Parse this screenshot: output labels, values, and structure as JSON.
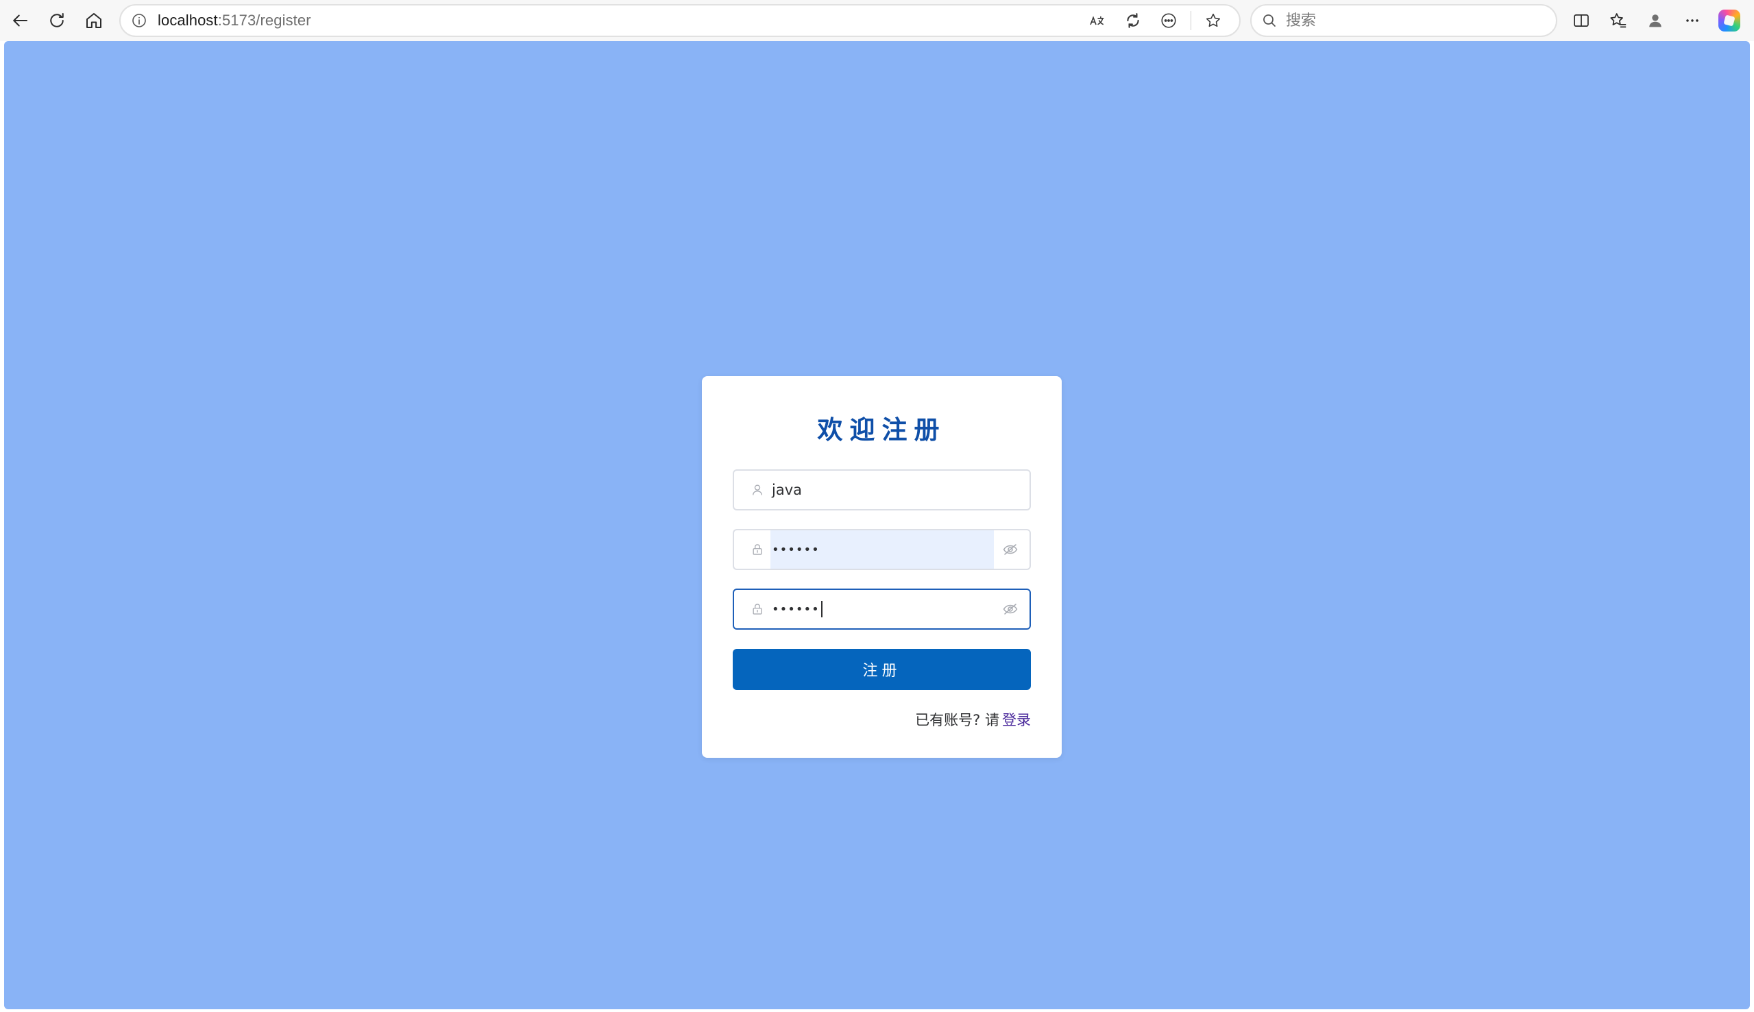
{
  "browser": {
    "address": {
      "host": "localhost",
      "path": ":5173/register"
    },
    "search": {
      "placeholder": "搜索"
    },
    "icons": {
      "back": "back-arrow-icon",
      "refresh": "refresh-icon",
      "home": "home-icon",
      "site_info": "info-icon",
      "read_aloud": "translate-icon",
      "browser_essentials": "refresh-shield-icon",
      "more_in_address": "more-circle-icon",
      "favorite": "star-icon",
      "split_screen": "split-screen-icon",
      "favorites": "favorites-icon",
      "profile": "profile-icon",
      "menu": "more-horizontal-icon",
      "copilot": "copilot-icon"
    }
  },
  "page": {
    "background_color": "#89b3f6",
    "title": "欢迎注册",
    "username": {
      "value": "java",
      "icon": "user-icon"
    },
    "password": {
      "value": "••••••",
      "icon": "lock-icon",
      "toggle_icon": "eye-off-icon",
      "autofilled": true
    },
    "confirm_password": {
      "value": "••••••",
      "icon": "lock-icon",
      "toggle_icon": "eye-off-icon",
      "focused": true
    },
    "submit_label": "注册",
    "footer": {
      "prompt": "已有账号? 请",
      "link_label": "登录"
    },
    "colors": {
      "title": "#0f4fa8",
      "button": "#0565bd",
      "link": "#4b2a9c"
    }
  }
}
